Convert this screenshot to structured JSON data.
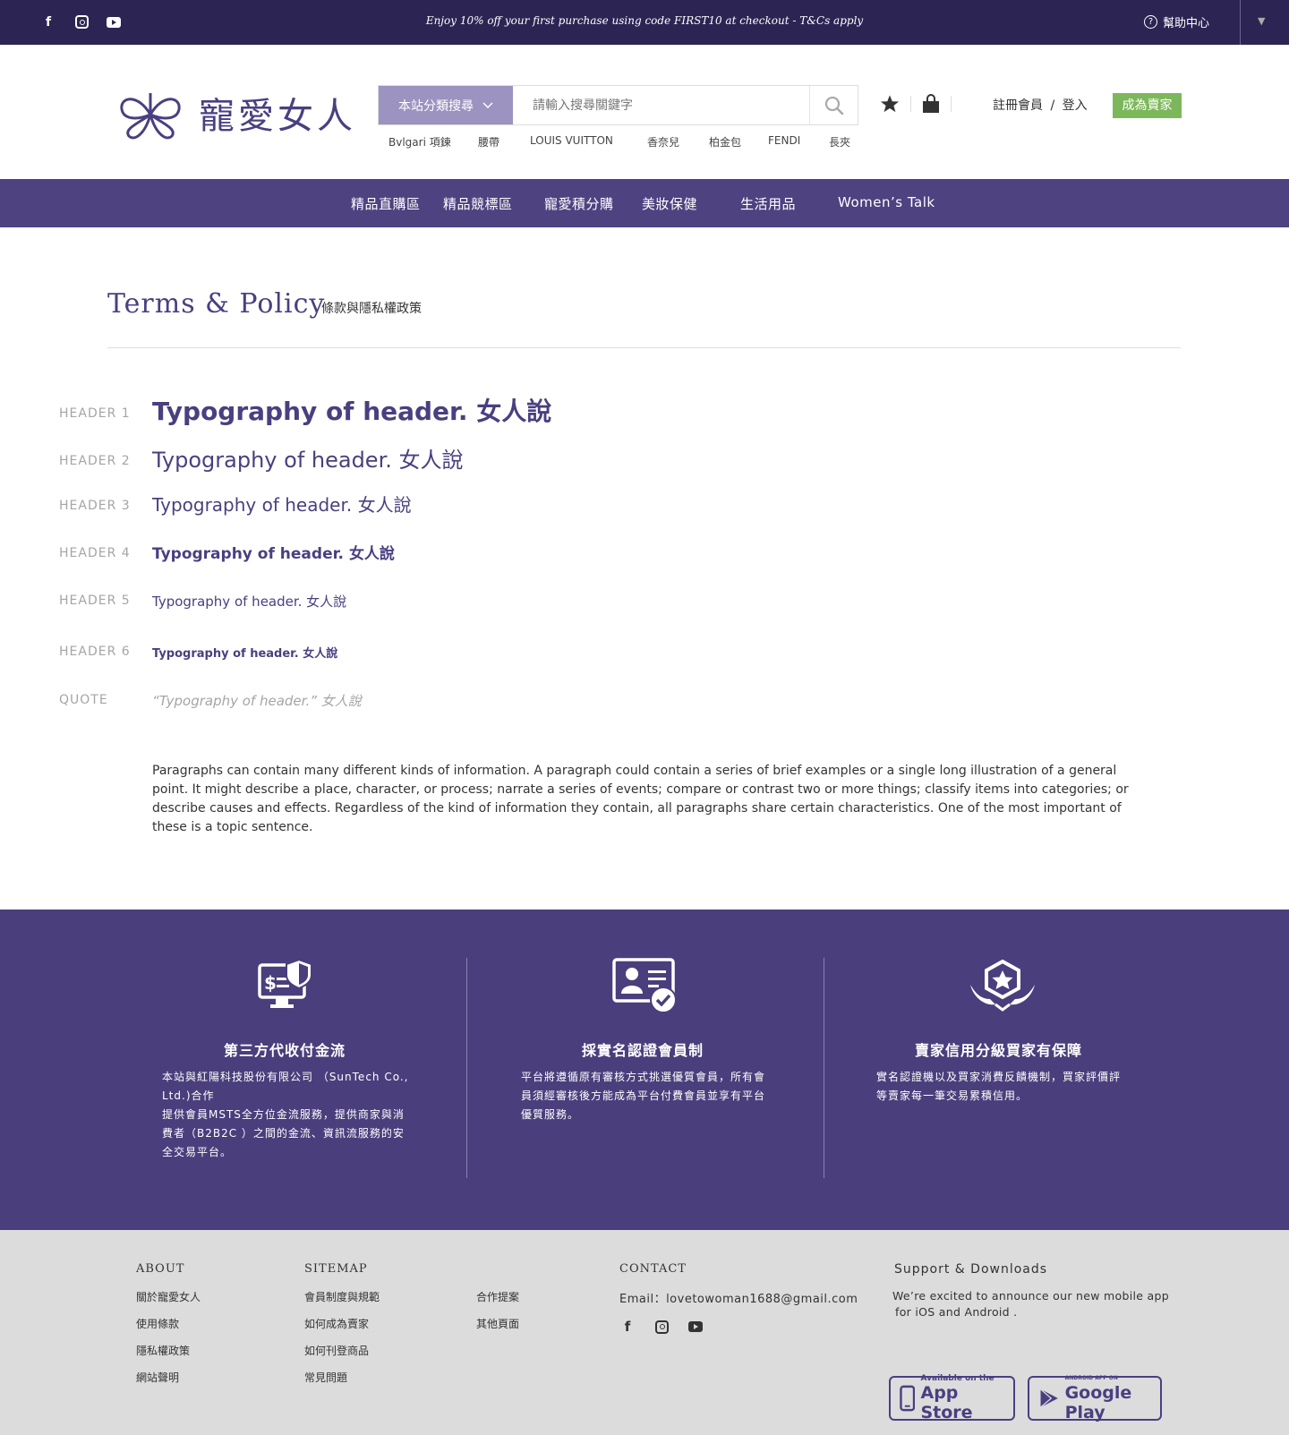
{
  "topbar": {
    "social_icons": [
      "facebook-icon",
      "instagram-icon",
      "youtube-icon"
    ],
    "promo": "Enjoy 10% off your first purchase using code FIRST10 at checkout - T&Cs apply",
    "help_label": "幫助中心",
    "help_icon": "question-icon",
    "dropdown_icon": "caret-down-icon"
  },
  "header": {
    "logo_text": "寵愛女人",
    "search": {
      "category_label": "本站分類搜尋",
      "placeholder": "請輸入搜尋關鍵字"
    },
    "tags": [
      "Bvlgari 項鍊",
      "腰帶",
      "LOUIS VUITTON",
      "香奈兒",
      "柏金包",
      "FENDI",
      "長夾"
    ],
    "register_label": "註冊會員",
    "auth_sep": "/",
    "login_label": "登入",
    "seller_label": "成為賣家"
  },
  "nav": {
    "items": [
      "精品直購區",
      "精品競標區",
      "寵愛積分購",
      "美妝保健",
      "生活用品",
      "Women’s Talk"
    ]
  },
  "page": {
    "title": "Terms & Policy",
    "subtitle": "條款與隱私權政策",
    "typography": [
      {
        "label": "HEADER 1",
        "text": "Typography of header. 女人說"
      },
      {
        "label": "HEADER 2",
        "text": "Typography of header. 女人說"
      },
      {
        "label": "HEADER 3",
        "text": "Typography of header. 女人說"
      },
      {
        "label": "HEADER 4",
        "text": "Typography of header. 女人說"
      },
      {
        "label": "HEADER 5",
        "text": "Typography of header. 女人說"
      },
      {
        "label": "HEADER 6",
        "text": "Typography of header. 女人說"
      },
      {
        "label": "QUOTE",
        "text": "“Typography of header.” 女人說"
      }
    ],
    "paragraph": "Paragraphs can contain many different kinds of information. A paragraph could contain a series of brief examples or a single long illustration of a general point. It might describe a place, character, or process; narrate a series of events; compare or contrast two or more things; classify items into categories; or describe causes and effects. Regardless of the kind of information they contain, all paragraphs share certain characteristics. One of the most important of these is a topic sentence."
  },
  "features": [
    {
      "icon": "secure-payment-icon",
      "title": "第三方代收付金流",
      "body": "本站與紅陽科技股份有限公司 （SunTech Co., Ltd.)合作\n提供會員MSTS全方位金流服務，提供商家與消費者（B2B2C ）之間的金流、資訊流服務的安全交易平台。"
    },
    {
      "icon": "verified-id-icon",
      "title": "採實名認證會員制",
      "body": "平台將遵循原有審核方式挑選優質會員，所有會員須經審核後方能成為平台付費會員並享有平台優質服務。"
    },
    {
      "icon": "star-badge-icon",
      "title": "賣家信用分級買家有保障",
      "body": "實名認證機以及買家消費反饋機制，買家評價評等賣家每一筆交易累積信用。"
    }
  ],
  "footer": {
    "about": {
      "heading": "ABOUT",
      "links": [
        "關於寵愛女人",
        "使用條款",
        "隱私權政策",
        "網站聲明"
      ]
    },
    "sitemap": {
      "heading": "SITEMAP",
      "links_col1": [
        "會員制度與規範",
        "如何成為賣家",
        "如何刊登商品",
        "常見問題"
      ],
      "links_col2": [
        "合作提案",
        "其他頁面"
      ]
    },
    "contact": {
      "heading": "CONTACT",
      "email": "Email：lovetowoman1688@gmail.com"
    },
    "support": {
      "heading": "Support & Downloads",
      "text_line1": "We’re excited to announce our new mobile app",
      "text_line2": "for iOS and Android .",
      "appstore_small": "Available on the",
      "appstore_big": "App Store",
      "googleplay_small": "ANDROID APP ON",
      "googleplay_big": "Google Play"
    }
  },
  "colors": {
    "brand": "#4a3f80",
    "topbar": "#2c2554",
    "nav": "#4f4280",
    "seller": "#7db75b",
    "footer": "#dcdcdd"
  }
}
